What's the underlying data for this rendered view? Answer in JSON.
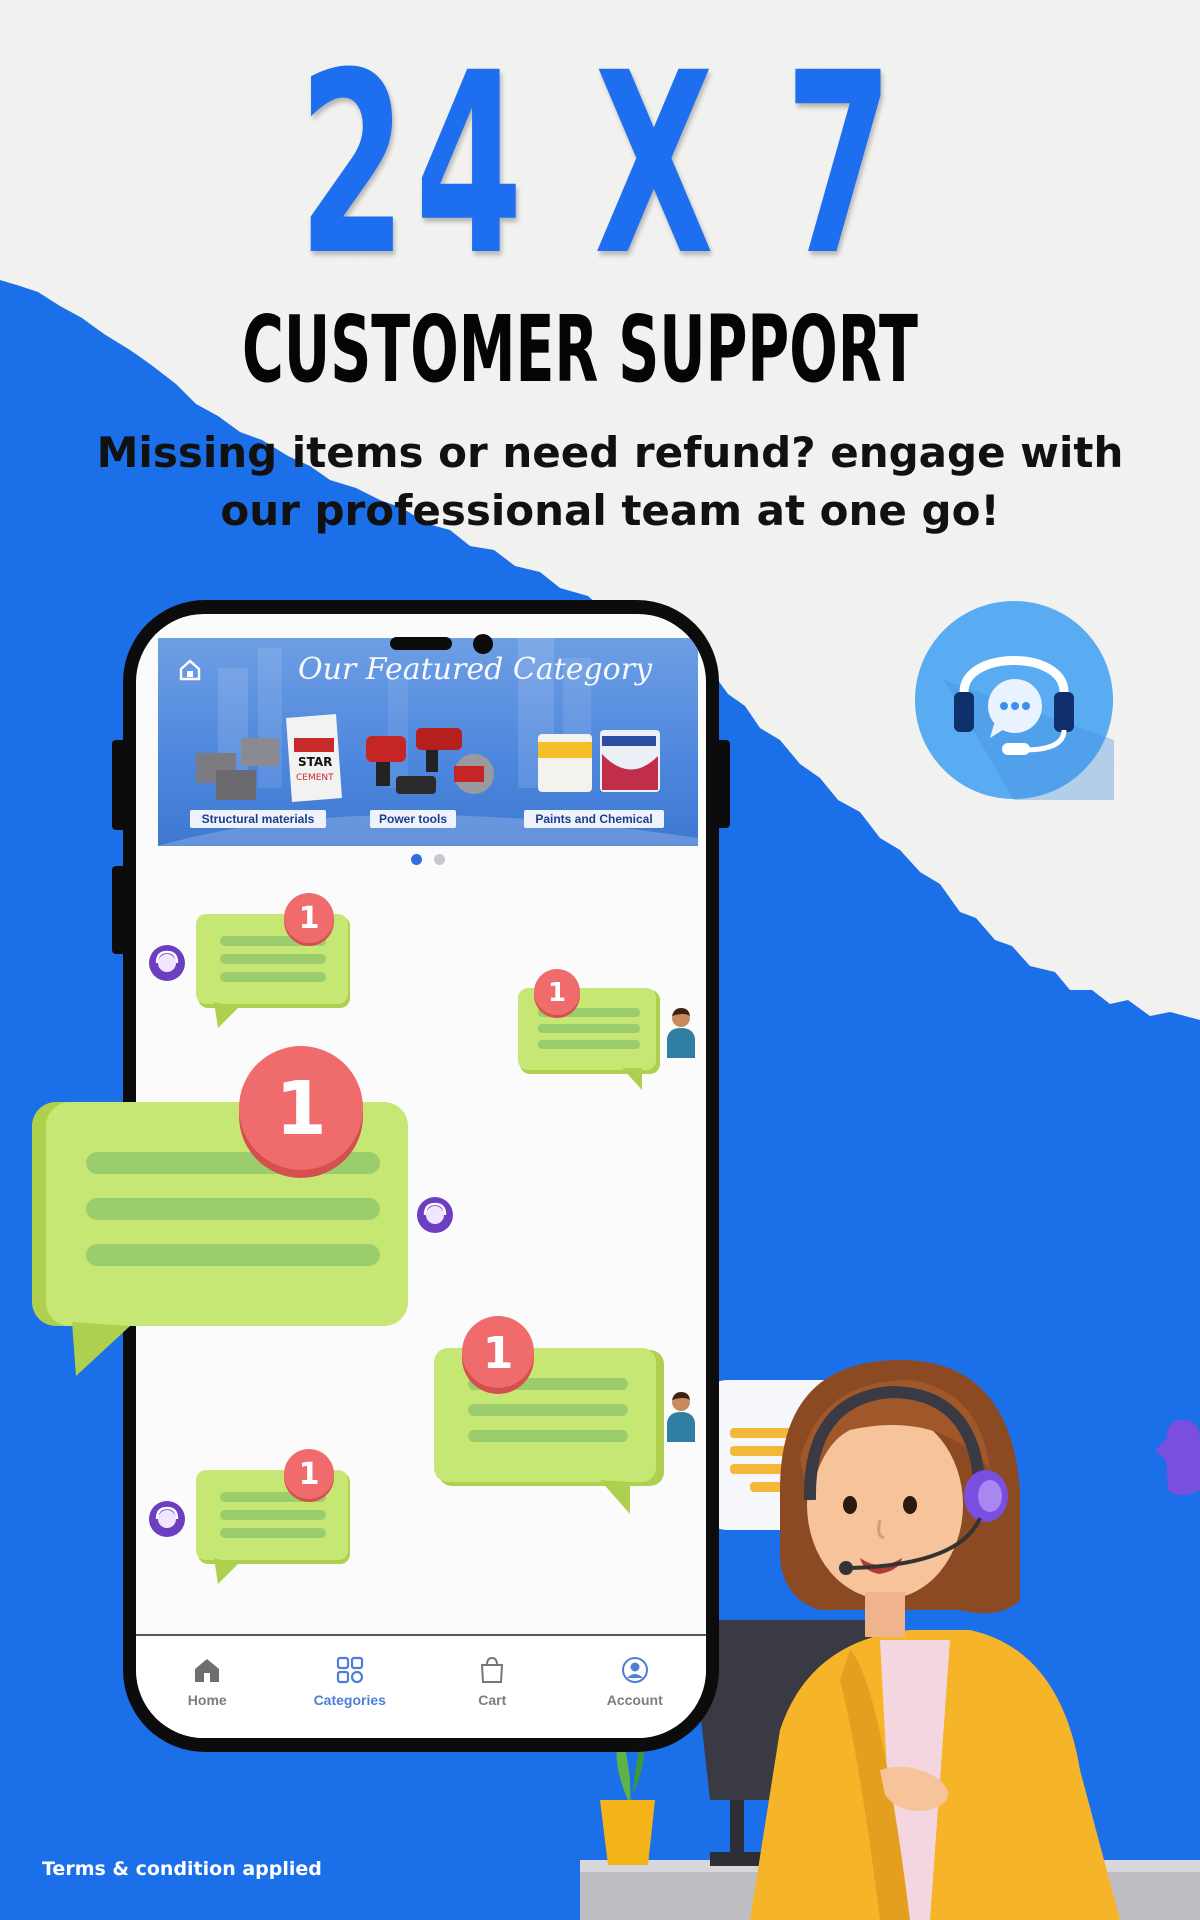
{
  "headline": "24 X 7",
  "subheadline": "CUSTOMER SUPPORT",
  "tagline": "Missing items or need refund? engage with our professional team at one go!",
  "banner": {
    "title": "Our Featured Category",
    "categories": [
      "Structural materials",
      "Power tools",
      "Paints and Chemical"
    ]
  },
  "carousel": {
    "pages": 2,
    "active": 1
  },
  "notifications": {
    "badge_1": "1",
    "badge_2": "1",
    "badge_3": "1",
    "badge_4": "1",
    "badge_5": "1"
  },
  "bottom_nav": {
    "items": [
      {
        "label": "Home",
        "icon": "home-icon"
      },
      {
        "label": "Categories",
        "icon": "grid-icon"
      },
      {
        "label": "Cart",
        "icon": "bag-icon"
      },
      {
        "label": "Account",
        "icon": "account-icon"
      }
    ],
    "active": "Categories"
  },
  "footer": {
    "terms": "Terms & condition applied"
  },
  "colors": {
    "brand_blue": "#1b6fe8",
    "bubble_green": "#c7e774",
    "badge_red": "#f06b6b",
    "agent_purple": "#6b3fbf"
  }
}
